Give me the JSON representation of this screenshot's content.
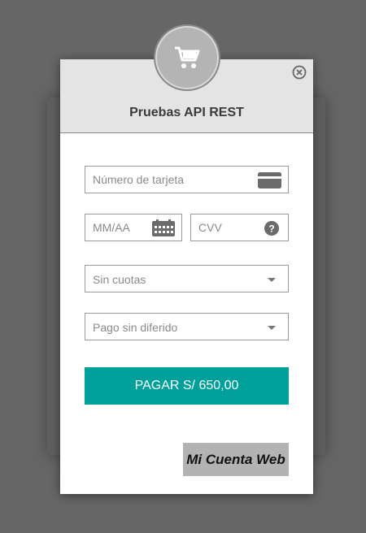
{
  "modal": {
    "title": "Pruebas API REST",
    "close_icon": "close-circle-icon",
    "logo_icon": "shopping-cart-icon"
  },
  "form": {
    "card_number": {
      "placeholder": "Número de tarjeta",
      "icon": "credit-card-icon"
    },
    "expiry": {
      "placeholder": "MM/AA",
      "icon": "calendar-icon"
    },
    "cvv": {
      "placeholder": "CVV",
      "icon": "help-icon"
    },
    "installments": {
      "selected": "Sin cuotas"
    },
    "deferral": {
      "selected": "Pago sin diferido"
    },
    "pay_button_label": "PAGAR S/ 650,00"
  },
  "footer": {
    "brand": "Mi Cuenta Web"
  },
  "colors": {
    "overlay": "#666666",
    "header": "#e4e4e4",
    "accent": "#00a09a",
    "badge": "#b3b3b3"
  }
}
